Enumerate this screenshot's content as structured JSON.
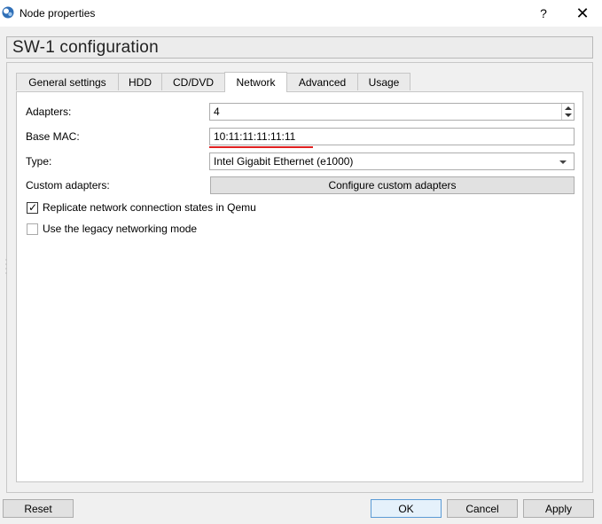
{
  "window": {
    "title": "Node properties",
    "help_label": "?",
    "close_label": "✕"
  },
  "header": {
    "title": "SW-1 configuration"
  },
  "tabs": [
    {
      "label": "General settings"
    },
    {
      "label": "HDD"
    },
    {
      "label": "CD/DVD"
    },
    {
      "label": "Network"
    },
    {
      "label": "Advanced"
    },
    {
      "label": "Usage"
    }
  ],
  "network": {
    "adapters_label": "Adapters:",
    "adapters_value": "4",
    "base_mac_label": "Base MAC:",
    "base_mac_value": "10:11:11:11:11:11",
    "type_label": "Type:",
    "type_value": "Intel Gigabit Ethernet (e1000)",
    "custom_adapters_label": "Custom adapters:",
    "configure_button_label": "Configure custom adapters",
    "replicate_label": "Replicate network connection states in Qemu",
    "replicate_checked": true,
    "legacy_label": "Use the legacy networking mode",
    "legacy_checked": false
  },
  "footer": {
    "reset_label": "Reset",
    "ok_label": "OK",
    "cancel_label": "Cancel",
    "apply_label": "Apply"
  },
  "colors": {
    "annotation_underline": "#e02020",
    "focus_border": "#5b9bd5"
  }
}
